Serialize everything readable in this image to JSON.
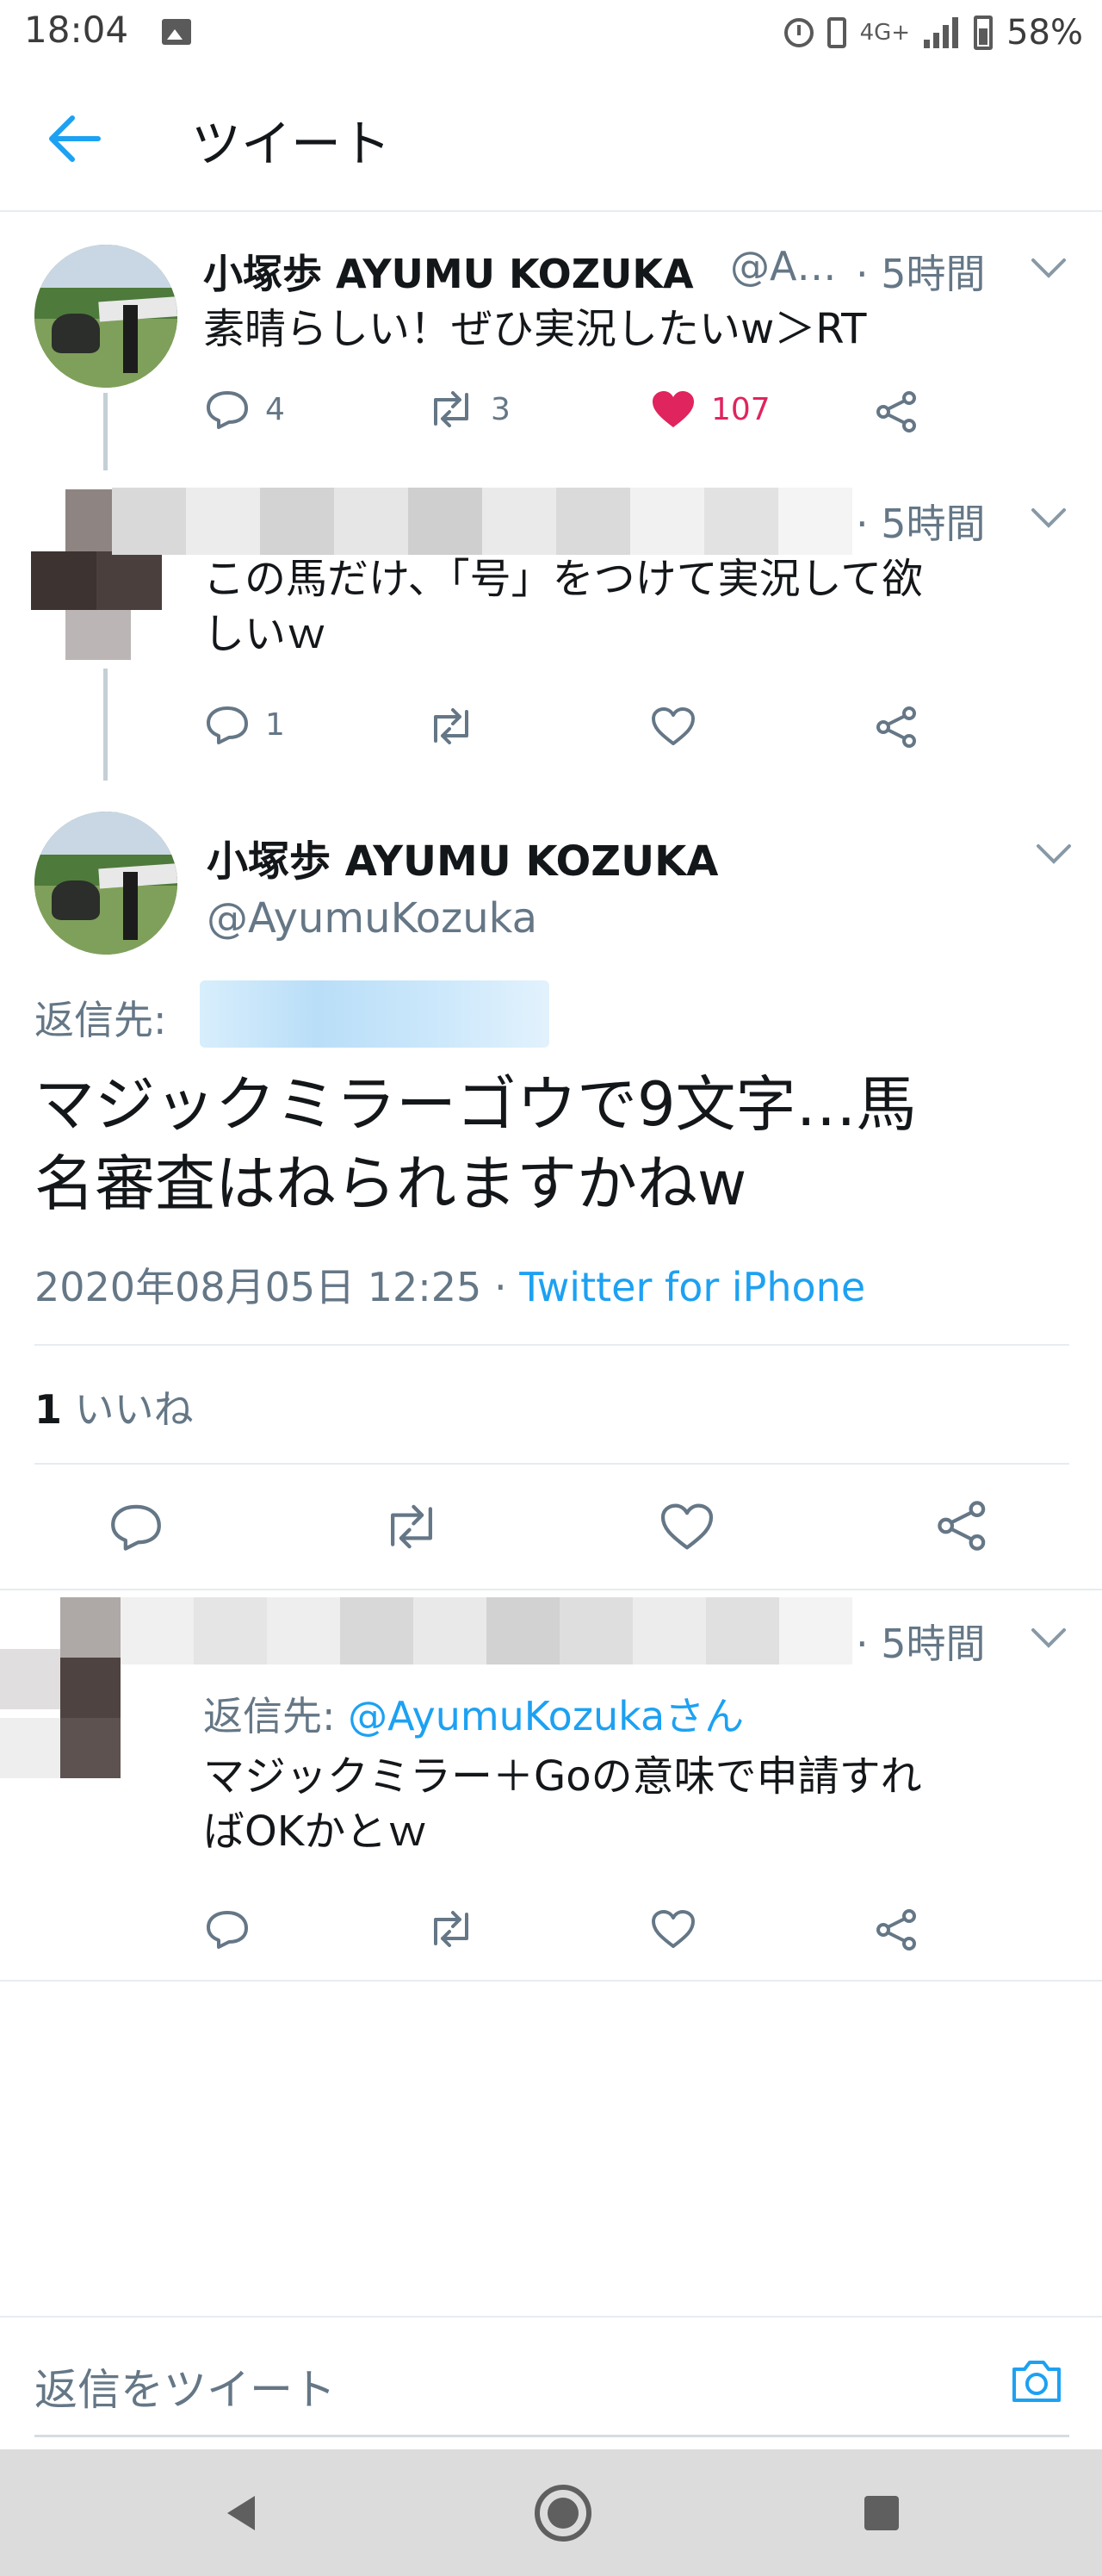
{
  "status_bar": {
    "time": "18:04",
    "network": "4G+",
    "battery": "58%",
    "icons": [
      "photo-icon",
      "alarm-icon",
      "vibrate-icon",
      "signal-icon",
      "battery-icon"
    ]
  },
  "header": {
    "title": "ツイート",
    "back_icon": "arrow-left-icon"
  },
  "colors": {
    "accent": "#1da1f2",
    "like": "#e0245e",
    "muted": "#657786",
    "text": "#14171a",
    "divider": "#e6ecf0"
  },
  "tweets": [
    {
      "name": "小塚歩 AYUMU KOZUKA",
      "handle": "@A…",
      "time": "· 5時間",
      "text_lines": [
        "素晴らしい！ぜひ実況したいw＞RT"
      ],
      "replies": "4",
      "retweets": "3",
      "likes": "107",
      "liked": true
    },
    {
      "name": "",
      "handle": "",
      "time": "· 5時間",
      "text_lines": [
        "この馬だけ、「号」をつけて実況して欲",
        "しいｗ"
      ],
      "replies": "1",
      "retweets": "",
      "likes": "",
      "liked": false
    }
  ],
  "main_tweet": {
    "name": "小塚歩 AYUMU KOZUKA",
    "handle": "@AyumuKozuka",
    "reply_to_label": "返信先:",
    "text_lines": [
      "マジックミラーゴウで9文字…馬",
      "名審査はねられますかねw"
    ],
    "timestamp": "2020年08月05日 12:25",
    "separator": "·",
    "source": "Twitter for iPhone",
    "like_count": "1",
    "like_label": "いいね"
  },
  "reply_tweet": {
    "time": "· 5時間",
    "reply_to_label": "返信先:",
    "reply_to_user": "@AyumuKozukaさん",
    "text_lines": [
      "マジックミラー＋Goの意味で申請すれ",
      "ばOKかとｗ"
    ]
  },
  "reply_input": {
    "placeholder": "返信をツイート"
  }
}
